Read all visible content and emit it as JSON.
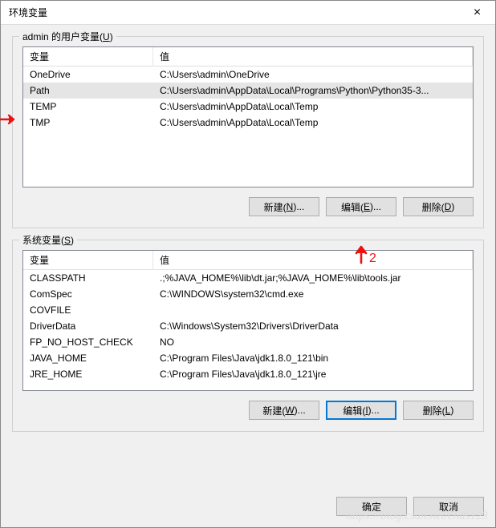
{
  "dialog": {
    "title": "环境变量",
    "close": "×"
  },
  "user_section": {
    "label_prefix": "admin 的用户变量(",
    "label_key": "U",
    "label_suffix": ")",
    "columns": {
      "name": "变量",
      "value": "值"
    },
    "rows": [
      {
        "name": "OneDrive",
        "value": "C:\\Users\\admin\\OneDrive",
        "selected": false
      },
      {
        "name": "Path",
        "value": "C:\\Users\\admin\\AppData\\Local\\Programs\\Python\\Python35-3...",
        "selected": true
      },
      {
        "name": "TEMP",
        "value": "C:\\Users\\admin\\AppData\\Local\\Temp",
        "selected": false
      },
      {
        "name": "TMP",
        "value": "C:\\Users\\admin\\AppData\\Local\\Temp",
        "selected": false
      }
    ],
    "buttons": {
      "new_label": "新建(",
      "new_key": "N",
      "new_suffix": ")...",
      "edit_label": "编辑(",
      "edit_key": "E",
      "edit_suffix": ")...",
      "del_label": "删除(",
      "del_key": "D",
      "del_suffix": ")"
    }
  },
  "system_section": {
    "label_prefix": "系统变量(",
    "label_key": "S",
    "label_suffix": ")",
    "columns": {
      "name": "变量",
      "value": "值"
    },
    "rows": [
      {
        "name": "CLASSPATH",
        "value": ".;%JAVA_HOME%\\lib\\dt.jar;%JAVA_HOME%\\lib\\tools.jar"
      },
      {
        "name": "ComSpec",
        "value": "C:\\WINDOWS\\system32\\cmd.exe"
      },
      {
        "name": "COVFILE",
        "value": ""
      },
      {
        "name": "DriverData",
        "value": "C:\\Windows\\System32\\Drivers\\DriverData"
      },
      {
        "name": "FP_NO_HOST_CHECK",
        "value": "NO"
      },
      {
        "name": "JAVA_HOME",
        "value": "C:\\Program Files\\Java\\jdk1.8.0_121\\bin"
      },
      {
        "name": "JRE_HOME",
        "value": "C:\\Program Files\\Java\\jdk1.8.0_121\\jre"
      }
    ],
    "buttons": {
      "new_label": "新建(",
      "new_key": "W",
      "new_suffix": ")...",
      "edit_label": "编辑(",
      "edit_key": "I",
      "edit_suffix": ")...",
      "del_label": "删除(",
      "del_key": "L",
      "del_suffix": ")"
    }
  },
  "footer": {
    "ok": "确定",
    "cancel": "取消"
  },
  "annotations": {
    "arrow2_label": "2"
  },
  "watermark": "https://blog.csdn.net/cnds123"
}
